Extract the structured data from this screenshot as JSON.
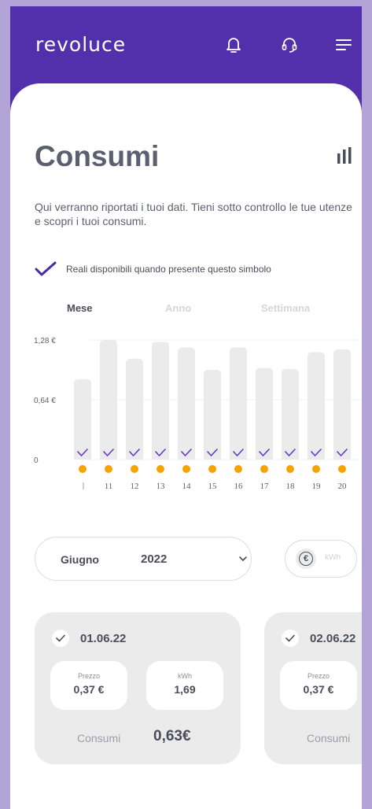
{
  "header": {
    "logo": "revoluce",
    "icons": [
      "bell-icon",
      "headset-icon",
      "menu-icon"
    ]
  },
  "page": {
    "title": "Consumi",
    "description": "Qui verranno riportati i tuoi dati. Tieni sotto controllo le tue utenze e scopri i tuoi consumi.",
    "legend": "Reali disponibili quando presente questo simbolo"
  },
  "tabs": [
    {
      "label": "Mese",
      "active": true
    },
    {
      "label": "Anno",
      "active": false
    },
    {
      "label": "Settimana",
      "active": false
    }
  ],
  "colors": {
    "brand": "#5230ac",
    "check": "#6a36c8",
    "dot": "#f5a300",
    "bar": "#ebebeb"
  },
  "chart_data": {
    "type": "bar",
    "categories": [
      "10",
      "11",
      "12",
      "13",
      "14",
      "15",
      "16",
      "17",
      "18",
      "19",
      "20"
    ],
    "visible_labels": [
      "11",
      "12",
      "13",
      "14",
      "15",
      "16",
      "17",
      "18",
      "19",
      "20"
    ],
    "values": [
      0.86,
      1.28,
      1.08,
      1.26,
      1.2,
      0.96,
      1.2,
      0.98,
      0.97,
      1.15,
      1.18
    ],
    "ylim": [
      0,
      1.28
    ],
    "yticks": [
      "1,28 €",
      "0,64 €",
      "0"
    ],
    "real_data_marks": true
  },
  "selector": {
    "month": "Giugno",
    "year": "2022",
    "units": [
      "€",
      "kWh"
    ]
  },
  "days": [
    {
      "date": "01.06.22",
      "price_label": "Prezzo",
      "price": "0,37 €",
      "kwh_label": "kWh",
      "kwh": "1,69",
      "total_label": "Consumi",
      "total": "0,63€"
    },
    {
      "date": "02.06.22",
      "price_label": "Prezzo",
      "price": "0,37 €",
      "total_label": "Consumi"
    }
  ]
}
